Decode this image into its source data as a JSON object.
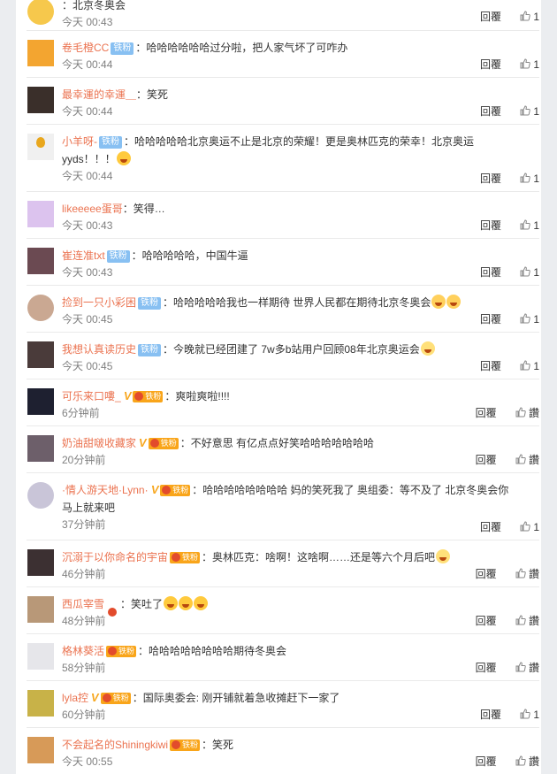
{
  "reply_label": "回覆",
  "comments": [
    {
      "name": "",
      "badge": "",
      "text": "：北京冬奥会",
      "time": "今天 00:43",
      "likes": "1",
      "avatar_color": "#f6c84c"
    },
    {
      "name": "卷毛橙CC",
      "badge": "铁粉",
      "text": "：哈哈哈哈哈哈过分啦，把人家气坏了可咋办",
      "time": "今天 00:44",
      "likes": "1",
      "avatar_color": "#f3a530"
    },
    {
      "name": "最幸運的幸運＿",
      "badge": "",
      "text": "：笑死",
      "time": "今天 00:44",
      "likes": "1",
      "avatar_color": "#3a2f2a"
    },
    {
      "name": "小羊呀-",
      "badge": "铁粉",
      "text": "：哈哈哈哈哈北京奥运不止是北京的荣耀！更是奥林匹克的荣幸！北京奥运",
      "text2": "yyds！！！",
      "time": "今天 00:44",
      "likes": "1",
      "avatar_color": "#f0f0f0"
    },
    {
      "name": "likeeeee蛋哥",
      "badge": "",
      "text": "：笑得…",
      "time": "今天 00:43",
      "likes": "1",
      "avatar_color": "#dcc3ee"
    },
    {
      "name": "崔连准txt",
      "badge": "铁粉",
      "text": "：哈哈哈哈哈，中国牛逼",
      "time": "今天 00:43",
      "likes": "1",
      "avatar_color": "#6b4a52"
    },
    {
      "name": "捡到一只小彩困",
      "badge": "铁粉",
      "text": "：哈哈哈哈哈我也一样期待 世界人民都在期待北京冬奥会",
      "time": "今天 00:45",
      "likes": "1",
      "avatar_color": "#caa892"
    },
    {
      "name": "我想认真读历史",
      "badge": "铁粉",
      "text": "：今晚就已经团建了 7w多b站用户回顾08年北京奥运会",
      "time": "今天 00:45",
      "likes": "1",
      "avatar_color": "#4a3b3a"
    },
    {
      "name": "可乐来口嘍_",
      "badge": "铁粉",
      "text": "：爽啦爽啦!!!!",
      "time": "6分钟前",
      "likes": "讚",
      "avatar_color": "#1e2030"
    },
    {
      "name": "奶油甜啵收藏家",
      "badge": "铁粉",
      "text": "：不好意思 有亿点点好笑哈哈哈哈哈哈哈",
      "time": "20分钟前",
      "likes": "讚",
      "avatar_color": "#6d5f6a"
    },
    {
      "name": "·情人游天地·Lynn·",
      "badge": "铁粉",
      "text": "：哈哈哈哈哈哈哈哈 妈的笑死我了 奥组委：等不及了 北京冬奥会你",
      "text2": "马上就来吧",
      "time": "37分钟前",
      "likes": "1",
      "avatar_color": "#c9c5d8"
    },
    {
      "name": "沉溺于以你命名的宇宙",
      "badge": "铁粉",
      "text": "：奥林匹克：啥啊！这啥啊……还是等六个月后吧",
      "time": "46分钟前",
      "likes": "讚",
      "avatar_color": "#3c3032"
    },
    {
      "name": "西瓜宰雪",
      "badge": "",
      "text": "：笑吐了",
      "time": "48分钟前",
      "likes": "讚",
      "avatar_color": "#b89878"
    },
    {
      "name": "格林葵活",
      "badge": "铁粉",
      "text": "：哈哈哈哈哈哈哈哈期待冬奥会",
      "time": "58分钟前",
      "likes": "讚",
      "avatar_color": "#e6e6ea"
    },
    {
      "name": "lyla控",
      "badge": "铁粉",
      "text": "：国际奥委会: 刚开铺就着急收摊赶下一家了",
      "time": "60分钟前",
      "likes": "1",
      "avatar_color": "#c8b248"
    },
    {
      "name": "不会起名的Shiningkiwi",
      "badge": "铁粉",
      "text": "：笑死",
      "time": "今天 00:55",
      "likes": "讚",
      "avatar_color": "#d79a58"
    }
  ]
}
